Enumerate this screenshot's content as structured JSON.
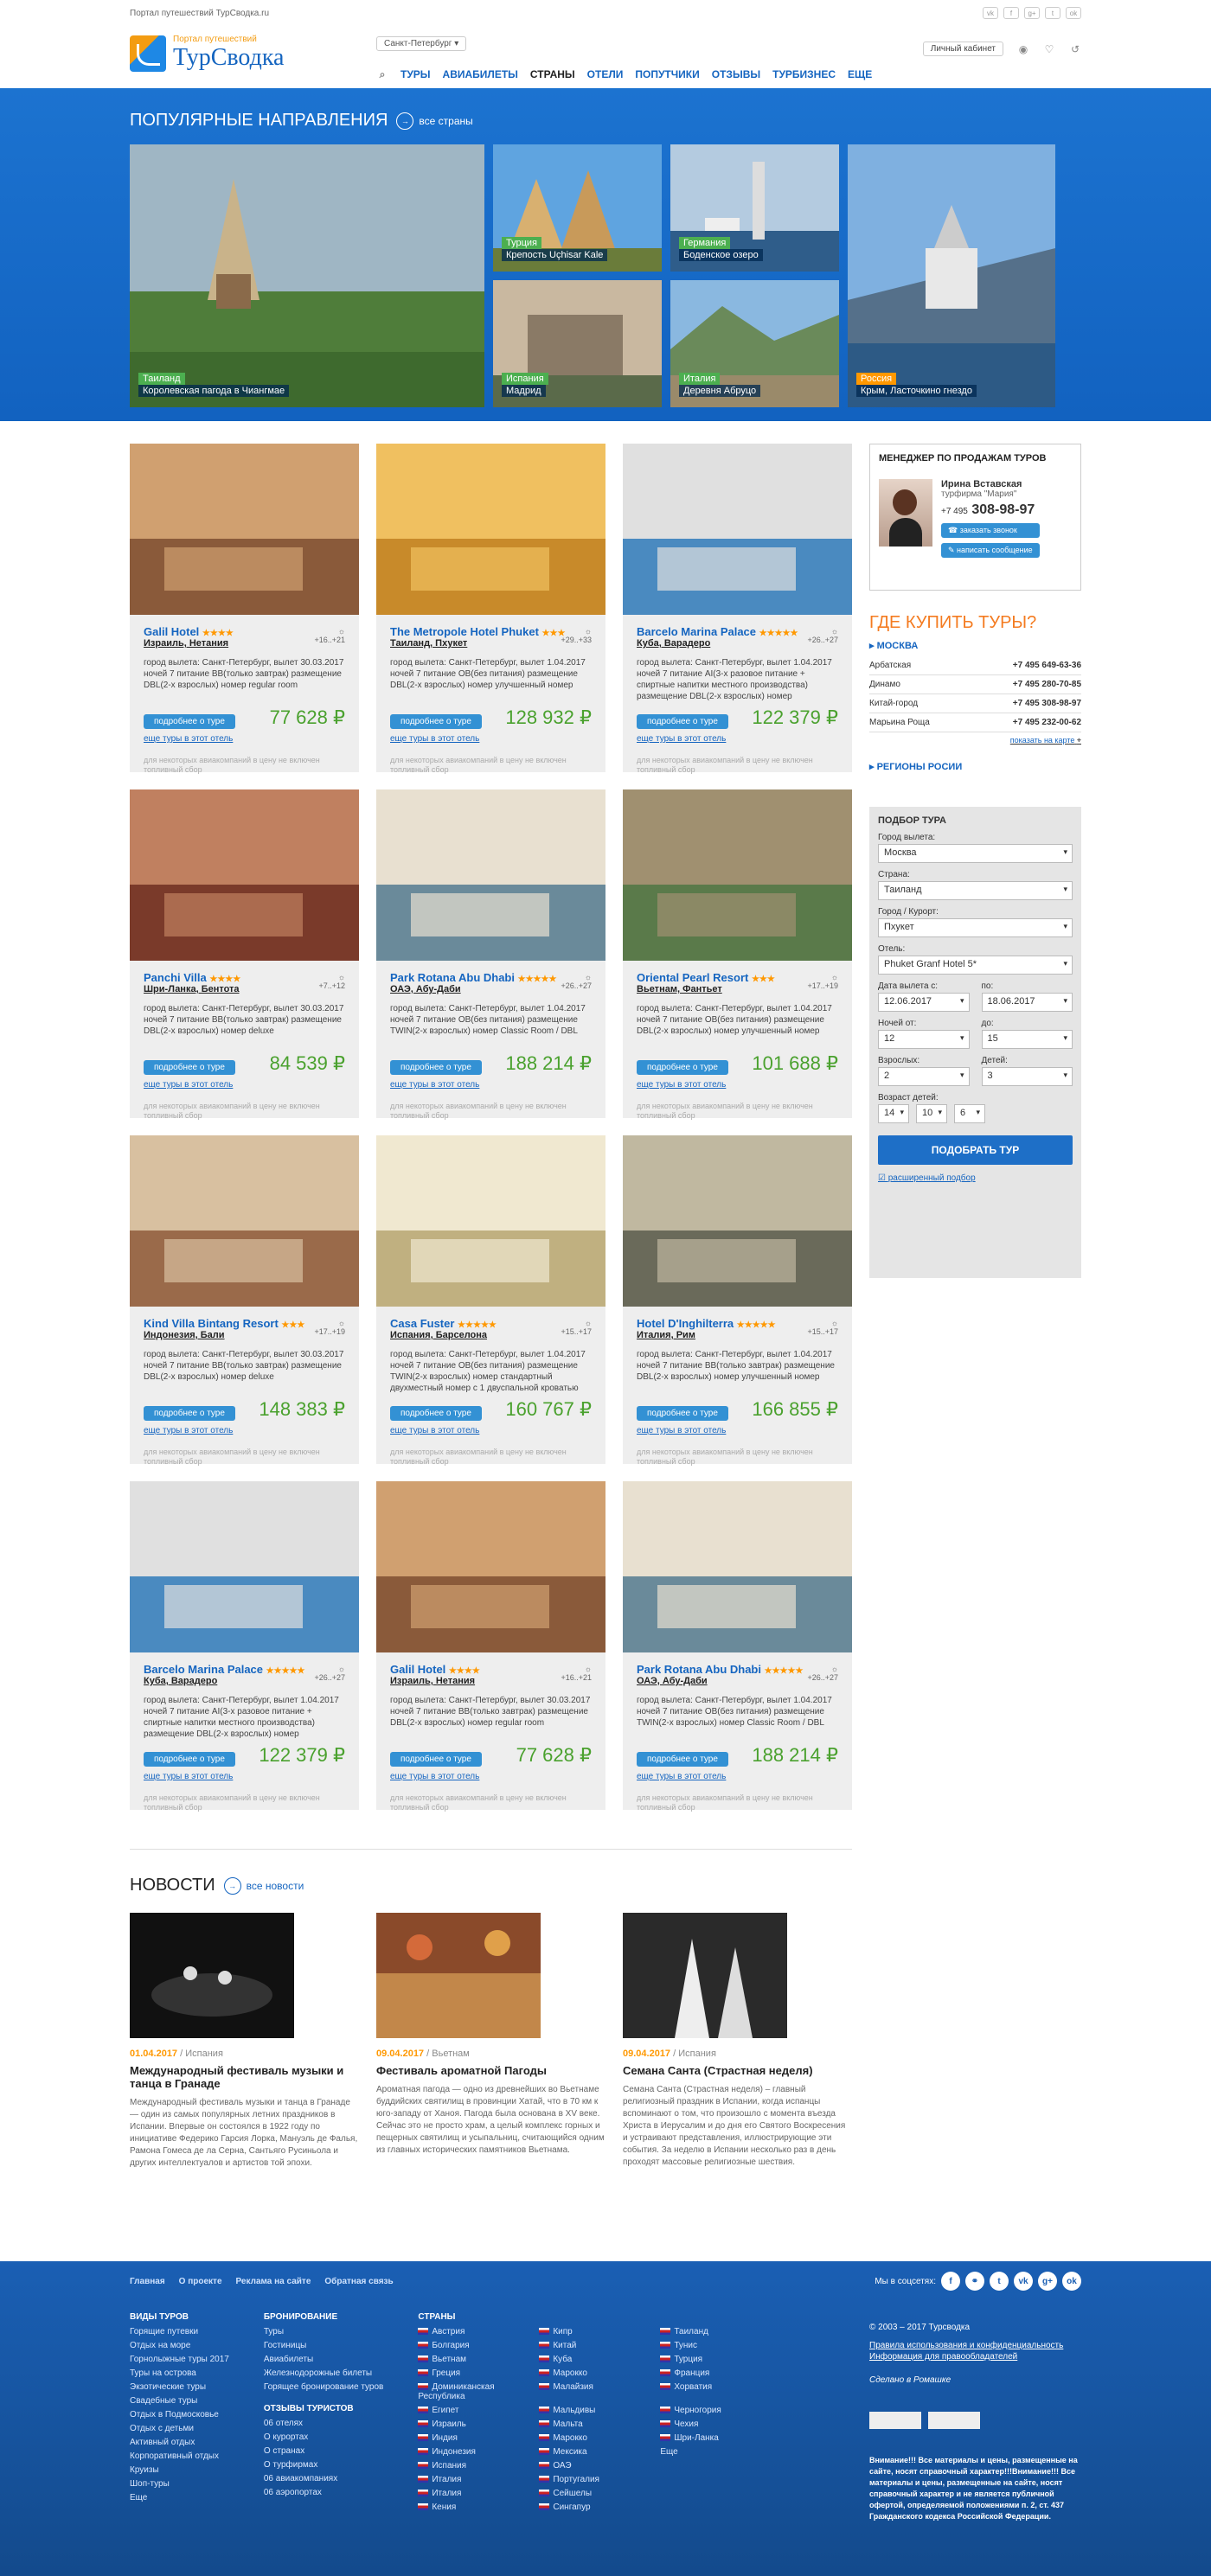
{
  "top": {
    "portal": "Портал путешествий ТурСводка.ru"
  },
  "logo": {
    "tag": "Портал путешествий",
    "name": "ТурСводка"
  },
  "city": "Санкт-Петербург",
  "nav": [
    "Туры",
    "Авиабилеты",
    "Страны",
    "Отели",
    "Попутчики",
    "Отзывы",
    "Турбизнес",
    "Еще"
  ],
  "cabinet": "Личный кабинет",
  "popular": {
    "title": "Популярные направления",
    "all": "все страны",
    "items": [
      {
        "country": "Таиланд",
        "place": "Королевская пагода в Чиангмае"
      },
      {
        "country": "Турция",
        "place": "Крепость Uçhisar Kale"
      },
      {
        "country": "Германия",
        "place": "Боденское озеро"
      },
      {
        "country": "Испания",
        "place": "Мадрид"
      },
      {
        "country": "Италия",
        "place": "Деревня Абруцо"
      },
      {
        "country": "Россия",
        "place": "Крым, Ласточкино гнездо"
      }
    ]
  },
  "labels": {
    "city_label": "город вылета:",
    "night_label": "ночей",
    "food_label": "питание",
    "room_label": "размещение",
    "more": "подробнее о туре",
    "other": "еще туры в этот отель",
    "note": "для некоторых авиакомпаний в цену не включен топливный сбор"
  },
  "cards": [
    {
      "name": "Galil Hotel",
      "stars": "★★★★",
      "loc": "Израиль, Нетания",
      "wx": "+16..+21",
      "details": "город вылета: Санкт-Петербург, вылет 30.03.2017 ночей 7 питание BB(только завтрак) размещение DBL(2-х взрослых) номер regular room",
      "price": "77 628 ₽"
    },
    {
      "name": "The Metropole Hotel Phuket",
      "stars": "★★★",
      "loc": "Таиланд, Пхукет",
      "wx": "+29..+33",
      "details": "город вылета: Санкт-Петербург, вылет 1.04.2017 ночей 7 питание OB(без питания) размещение DBL(2-х взрослых) номер улучшенный номер",
      "price": "128 932 ₽"
    },
    {
      "name": "Barcelo Marina Palace",
      "stars": "★★★★★",
      "loc": "Куба, Варадеро",
      "wx": "+26..+27",
      "details": "город вылета: Санкт-Петербург, вылет 1.04.2017 ночей 7 питание AI(3-х разовое питание + спиртные напитки местного производства) размещение DBL(2-х взрослых) номер улучшенный номер",
      "price": "122 379 ₽"
    },
    {
      "name": "Panchi Villa",
      "stars": "★★★★",
      "loc": "Шри-Ланка, Бентота",
      "wx": "+7..+12",
      "details": "город вылета: Санкт-Петербург, вылет 30.03.2017 ночей 7 питание BB(только завтрак) размещение DBL(2-х взрослых) номер deluxe",
      "price": "84 539 ₽"
    },
    {
      "name": "Park Rotana Abu Dhabi",
      "stars": "★★★★★",
      "loc": "ОАЭ, Абу-Даби",
      "wx": "+26..+27",
      "details": "город вылета: Санкт-Петербург, вылет 1.04.2017 ночей 7 питание OB(без питания) размещение TWIN(2-х взрослых) номер Classic Room / DBL",
      "price": "188 214 ₽"
    },
    {
      "name": "Oriental Pearl Resort",
      "stars": "★★★",
      "loc": "Вьетнам, Фантьет",
      "wx": "+17..+19",
      "details": "город вылета: Санкт-Петербург, вылет 1.04.2017 ночей 7 питание OB(без питания) размещение DBL(2-х взрослых) номер улучшенный номер",
      "price": "101 688 ₽"
    },
    {
      "name": "Kind Villa Bintang Resort",
      "stars": "★★★",
      "loc": "Индонезия, Бали",
      "wx": "+17..+19",
      "details": "город вылета: Санкт-Петербург, вылет 30.03.2017 ночей 7 питание BB(только завтрак) размещение DBL(2-х взрослых) номер deluxe",
      "price": "148 383 ₽"
    },
    {
      "name": "Casa Fuster",
      "stars": "★★★★★",
      "loc": "Испания, Барселона",
      "wx": "+15..+17",
      "details": "город вылета: Санкт-Петербург, вылет 1.04.2017 ночей 7 питание OB(без питания) размещение TWIN(2-х взрослых) номер стандартный двухместный номер с 1 двуспальной кроватью",
      "price": "160 767 ₽"
    },
    {
      "name": "Hotel D'Inghilterra",
      "stars": "★★★★★",
      "loc": "Италия, Рим",
      "wx": "+15..+17",
      "details": "город вылета: Санкт-Петербург, вылет 1.04.2017 ночей 7 питание BB(только завтрак) размещение DBL(2-х взрослых) номер улучшенный номер",
      "price": "166 855 ₽"
    },
    {
      "name": "Barcelo Marina Palace",
      "stars": "★★★★★",
      "loc": "Куба, Варадеро",
      "wx": "+26..+27",
      "details": "город вылета: Санкт-Петербург, вылет 1.04.2017 ночей 7 питание AI(3-х разовое питание + спиртные напитки местного производства) размещение DBL(2-х взрослых) номер улучшенный номер",
      "price": "122 379 ₽"
    },
    {
      "name": "Galil Hotel",
      "stars": "★★★★",
      "loc": "Израиль, Нетания",
      "wx": "+16..+21",
      "details": "город вылета: Санкт-Петербург, вылет 30.03.2017 ночей 7 питание BB(только завтрак) размещение DBL(2-х взрослых) номер regular room",
      "price": "77 628 ₽"
    },
    {
      "name": "Park Rotana Abu Dhabi",
      "stars": "★★★★★",
      "loc": "ОАЭ, Абу-Даби",
      "wx": "+26..+27",
      "details": "город вылета: Санкт-Петербург, вылет 1.04.2017 ночей 7 питание OB(без питания) размещение TWIN(2-х взрослых) номер Classic Room / DBL",
      "price": "188 214 ₽"
    }
  ],
  "manager": {
    "title": "Менеджер по продажам туров",
    "name": "Ирина Вставская",
    "role": "турфирма \"Мария\"",
    "phone_code": "+7 495",
    "phone": "308-98-97",
    "call": "заказать звонок",
    "msg": "написать сообщение"
  },
  "buy": {
    "title": "Где купить туры?",
    "city": "МОСКВА",
    "rows": [
      [
        "Арбатская",
        "+7 495 649-63-36"
      ],
      [
        "Динамо",
        "+7 495 280-70-85"
      ],
      [
        "Китай-город",
        "+7 495 308-98-97"
      ],
      [
        "Марьина Роща",
        "+7 495 232-00-62"
      ]
    ],
    "map": "показать на карте",
    "regions": "РЕГИОНЫ РОСИИ"
  },
  "filter": {
    "title": "Подбор тура",
    "from_l": "Город вылета:",
    "from": "Москва",
    "country_l": "Страна:",
    "country": "Таиланд",
    "resort_l": "Город / Курорт:",
    "resort": "Пхукет",
    "hotel_l": "Отель:",
    "hotel": "Phuket Granf Hotel 5*",
    "d1_l": "Дата вылета с:",
    "d1": "12.06.2017",
    "d2_l": "по:",
    "d2": "18.06.2017",
    "n1_l": "Ночей от:",
    "n1": "12",
    "n2_l": "до:",
    "n2": "15",
    "ad_l": "Взрослых:",
    "ad": "2",
    "ch_l": "Детей:",
    "ch": "3",
    "age_l": "Возраст детей:",
    "ages": [
      "14",
      "10",
      "6"
    ],
    "go": "Подобрать тур",
    "adv": "расширенный подбор"
  },
  "news": {
    "title": "Новости",
    "all": "все новости",
    "items": [
      {
        "date": "01.04.2017",
        "country": "Испания",
        "title": "Международный фестиваль музыки и танца в Гранаде",
        "text": "Международный фестиваль музыки и танца в Гранаде — один из самых популярных летних праздников в Испании. Впервые он состоялся в 1922 году по инициативе Федерико Гарсия Лорка, Мануэль де Фалья, Рамона Гомеса де ла Серна, Сантьяго Русиньола и других интеллектуалов и артистов той эпохи."
      },
      {
        "date": "09.04.2017",
        "country": "Вьетнам",
        "title": "Фестиваль ароматной Пагоды",
        "text": "Ароматная пагода — одно из древнейших во Вьетнаме буддийских святилищ в провинции Хатай, что в 70 км к юго-западу от Ханоя. Пагода была основана в XV веке. Сейчас это не просто храм, а целый комплекс горных и пещерных святилищ и усыпальниц, считающийся одним из главных исторических памятников Вьетнама."
      },
      {
        "date": "09.04.2017",
        "country": "Испания",
        "title": "Семана Санта (Страстная неделя)",
        "text": "Семана Санта (Страстная неделя) – главный религиозный праздник в Испании, когда испанцы вспоминают о том, что произошло с момента въезда Христа в Иерусалим и до дня его Святого Воскресения и устраивают представления, иллюстрирующие эти события. За неделю в Испании несколько раз в день проходят массовые религиозные шествия."
      }
    ]
  },
  "footer": {
    "nav": [
      "Главная",
      "О проекте",
      "Реклама на сайте",
      "Обратная связь"
    ],
    "social": "Мы в соцсетях:",
    "tours_h": "Виды туров",
    "tours": [
      "Горящие путевки",
      "Отдых на море",
      "Горнолыжные туры 2017",
      "Туры на острова",
      "Экзотические туры",
      "Свадебные туры",
      "Отдых в Подмосковье",
      "Отдых с детьми",
      "Активный отдых",
      "Корпоративный отдых",
      "Круизы",
      "Шоп-туры",
      "Еще"
    ],
    "book_h": "Бронирование",
    "book": [
      "Туры",
      "Гостиницы",
      "Авиабилеты",
      "Железнодорожные билеты",
      "Горящее бронирование туров"
    ],
    "rev_h": "Отзывы туристов",
    "rev": [
      "06 отелях",
      "О курортах",
      "О странах",
      "О турфирмах",
      "06 авиакомпаниях",
      "06 аэропортах"
    ],
    "countries_h": "Страны",
    "countries": [
      "Австрия",
      "Кипр",
      "Таиланд",
      "Болгария",
      "Китай",
      "Тунис",
      "Вьетнам",
      "Куба",
      "Турция",
      "Греция",
      "Марокко",
      "Франция",
      "Доминиканская Республика",
      "Малайзия",
      "Хорватия",
      "Египет",
      "Мальдивы",
      "Черногория",
      "Израиль",
      "Мальта",
      "Чехия",
      "Индия",
      "Марокко",
      "Шри-Ланка",
      "Индонезия",
      "Мексика",
      "Еще",
      "Испания",
      "ОАЭ",
      "",
      "Италия",
      "Португалия",
      "",
      "Италия",
      "Сейшелы",
      "",
      "Кения",
      "Сингапур",
      ""
    ],
    "copy": "© 2003 – 2017 Турсводка",
    "policy": "Правила использования и конфиденциальность Информация для правообладателей",
    "counters": "Сделано в Ромашке",
    "warn": "Внимание!!! Все материалы и цены, размещенные на сайте, носят справочный характер!!!Внимание!!! Все материалы и цены, размещенные на сайте, носят справочный характер и не является публичной офертой, определяемой положениями п. 2, ст. 437 Гражданского кодекса Российской Федерации."
  }
}
